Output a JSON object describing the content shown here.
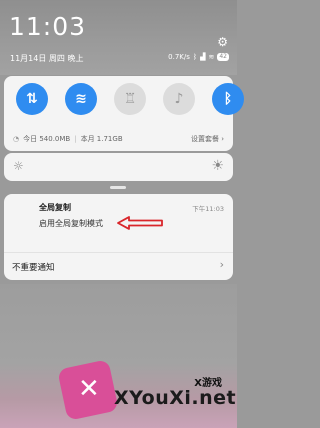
{
  "status_bar": {
    "time": "11:03",
    "date": "11月14日 周四 晚上",
    "network_speed": "0.7K/s",
    "battery": "42",
    "icons": [
      "bluetooth-icon",
      "signal-icon",
      "wifi-icon",
      "battery-icon",
      "settings-gear-icon"
    ]
  },
  "quick_toggles": [
    {
      "name": "data",
      "icon": "mobile-data-icon",
      "glyph": "⇅",
      "on": true
    },
    {
      "name": "wifi",
      "icon": "wifi-icon",
      "glyph": "≋",
      "on": true
    },
    {
      "name": "flashlight",
      "icon": "flashlight-icon",
      "glyph": "♖",
      "on": false
    },
    {
      "name": "mute",
      "icon": "mute-bell-icon",
      "glyph": "♪",
      "on": false
    },
    {
      "name": "bluetooth",
      "icon": "bluetooth-icon",
      "glyph": "ᛒ",
      "on": true
    }
  ],
  "usage": {
    "today": "今日 540.0MB",
    "month": "本月 1.71GB",
    "settings_link": "设置套餐 ›"
  },
  "brightness": {
    "left_icon": "brightness-low-icon",
    "right_icon": "brightness-high-icon",
    "level": 0
  },
  "notification": {
    "title": "全局复制",
    "body": "启用全局复制模式",
    "time": "下午11:03"
  },
  "less_important": {
    "label": "不重要通知",
    "chevron": "›"
  },
  "watermark": {
    "title": "X游戏",
    "url": "XYouXi.net"
  },
  "colors": {
    "accent": "#2f8cf0",
    "arrow": "#d9262b",
    "panel": "#f4f4f4"
  }
}
